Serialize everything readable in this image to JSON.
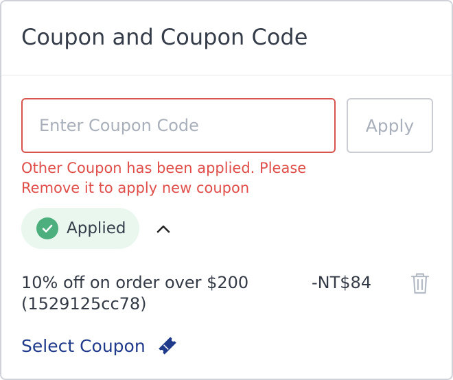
{
  "header": {
    "title": "Coupon and Coupon Code"
  },
  "coupon_form": {
    "input_value": "",
    "input_placeholder": "Enter Coupon Code",
    "apply_label": "Apply",
    "error_message": "Other Coupon has been applied. Please Remove it to apply new coupon"
  },
  "applied_section": {
    "status_label": "Applied",
    "expanded": true,
    "status_icon": "check-circle-icon",
    "toggle_icon": "chevron-up-icon"
  },
  "applied_coupon": {
    "description": "10% off on order over $200 (1529125cc78)",
    "discount": "-NT$84",
    "remove_icon": "trash-icon"
  },
  "select_coupon": {
    "label": "Select Coupon",
    "icon": "ticket-icon"
  },
  "colors": {
    "error": "#e04e4a",
    "success": "#4caf7d",
    "success_bg": "#eaf7ef",
    "link": "#1f3a8a",
    "muted": "#a9b0bb"
  }
}
